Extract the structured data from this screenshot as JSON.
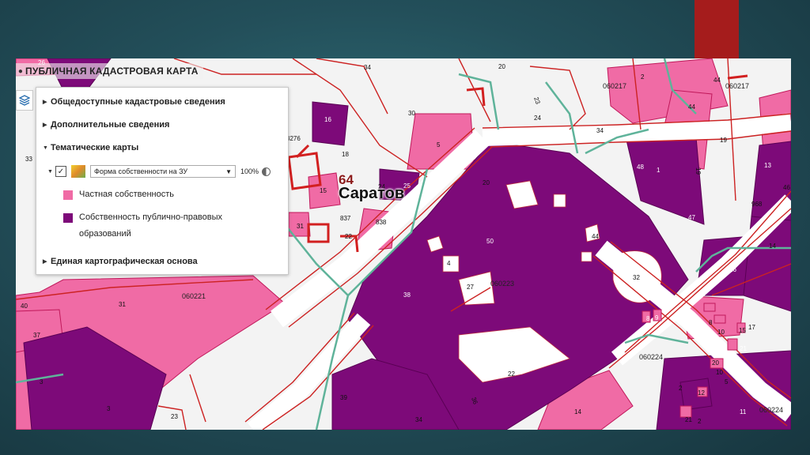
{
  "app": {
    "title": "ПУБЛИЧНАЯ КАДАСТРОВАЯ КАРТА"
  },
  "panel": {
    "sections": {
      "public": "Общедоступные кадастровые сведения",
      "additional": "Дополнительные сведения",
      "thematic": "Тематические карты",
      "base": "Единая картографическая основа"
    },
    "layer": {
      "select_value": "Форма собственности на ЗУ",
      "opacity": "100%"
    },
    "legend": [
      {
        "label": "Частная собственность",
        "color": "#f06ba5"
      },
      {
        "label_line1": "Собственность публично-правовых",
        "label_line2": "образований",
        "color": "#7d0a79"
      }
    ]
  },
  "map": {
    "region_code": "64",
    "city": "Саратов",
    "colors": {
      "private": "#f06ba5",
      "public": "#7d0a79",
      "road": "#ffffff",
      "boundary": "#cc2222",
      "quarter_line": "#5fb39a"
    },
    "quarters": [
      "060217",
      "060217",
      "060221",
      "060223",
      "060224",
      "060224"
    ],
    "parcels": [
      "26",
      "34",
      "20",
      "2",
      "44",
      "30",
      "24",
      "23",
      "34",
      "19",
      "13",
      "46",
      "3276",
      "18",
      "5",
      "48",
      "1",
      "15",
      "64",
      "24",
      "25",
      "50",
      "10",
      "47",
      "44",
      "33",
      "31",
      "837",
      "22",
      "838",
      "4",
      "27",
      "32",
      "26",
      "40",
      "31",
      "38",
      "14",
      "37",
      "3",
      "8",
      "9",
      "22",
      "39",
      "34",
      "36",
      "14",
      "2",
      "21",
      "11",
      "3",
      "23",
      "8",
      "10",
      "5",
      "16",
      "968",
      "10",
      "17",
      "12",
      "20",
      "15",
      "2"
    ]
  }
}
